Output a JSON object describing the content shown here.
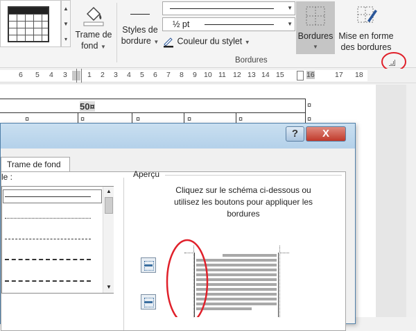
{
  "ribbon": {
    "shading_label_line1": "Trame de",
    "shading_label_line2": "fond",
    "border_styles_line1": "Styles de",
    "border_styles_line2": "bordure",
    "pen_weight": "½ pt",
    "pen_color_label": "Couleur du stylet",
    "borders_label": "Bordures",
    "painter_line1": "Mise en forme",
    "painter_line2": "des bordures",
    "group_label": "Bordures"
  },
  "ruler": {
    "labels": [
      "6",
      "5",
      "4",
      "3",
      "2",
      "1",
      "1",
      "2",
      "3",
      "4",
      "5",
      "6",
      "7",
      "8",
      "9",
      "10",
      "11",
      "12",
      "13",
      "14",
      "15",
      "16",
      "17",
      "18"
    ]
  },
  "document": {
    "cell_value": "50¤",
    "cell_mark": "¤"
  },
  "dialog": {
    "help_label": "?",
    "close_label": "X",
    "tab_shading": "Trame de fond",
    "style_label_fragment": "le :",
    "preview_label": "Aperçu",
    "instruction_line1": "Cliquez sur le schéma ci-dessous ou",
    "instruction_line2": "utilisez les boutons pour appliquer les",
    "instruction_line3": "bordures"
  },
  "colors": {
    "annotation_red": "#e0202a",
    "close_button": "#c9463d",
    "title_bar": "#b9d4ec"
  }
}
